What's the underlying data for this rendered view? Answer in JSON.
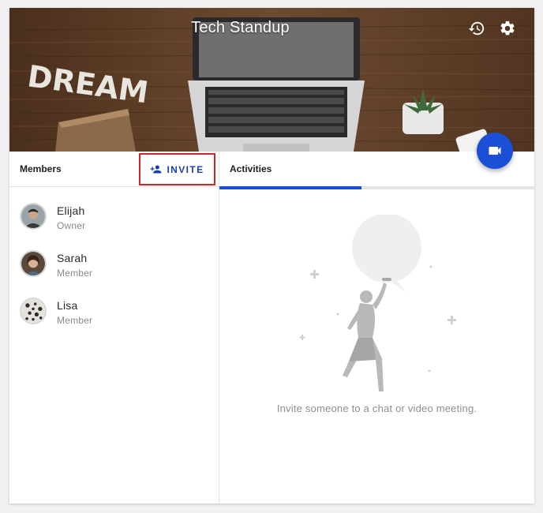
{
  "banner": {
    "title": "Tech Standup",
    "decor_text": "DREAM",
    "history_icon": "history-icon",
    "settings_icon": "gear-icon"
  },
  "fab": {
    "icon": "video-camera-icon",
    "color": "#1a4fd6"
  },
  "members_panel": {
    "title": "Members",
    "invite_label": "INVITE",
    "invite_icon": "add-person-icon",
    "members": [
      {
        "name": "Elijah",
        "role": "Owner"
      },
      {
        "name": "Sarah",
        "role": "Member"
      },
      {
        "name": "Lisa",
        "role": "Member"
      }
    ]
  },
  "activities_panel": {
    "tab_label": "Activities",
    "empty_message": "Invite someone to a chat or video meeting."
  },
  "colors": {
    "accent": "#1a4fd6",
    "invite_text": "#1a3fa6",
    "highlight_border": "#c9262c"
  }
}
